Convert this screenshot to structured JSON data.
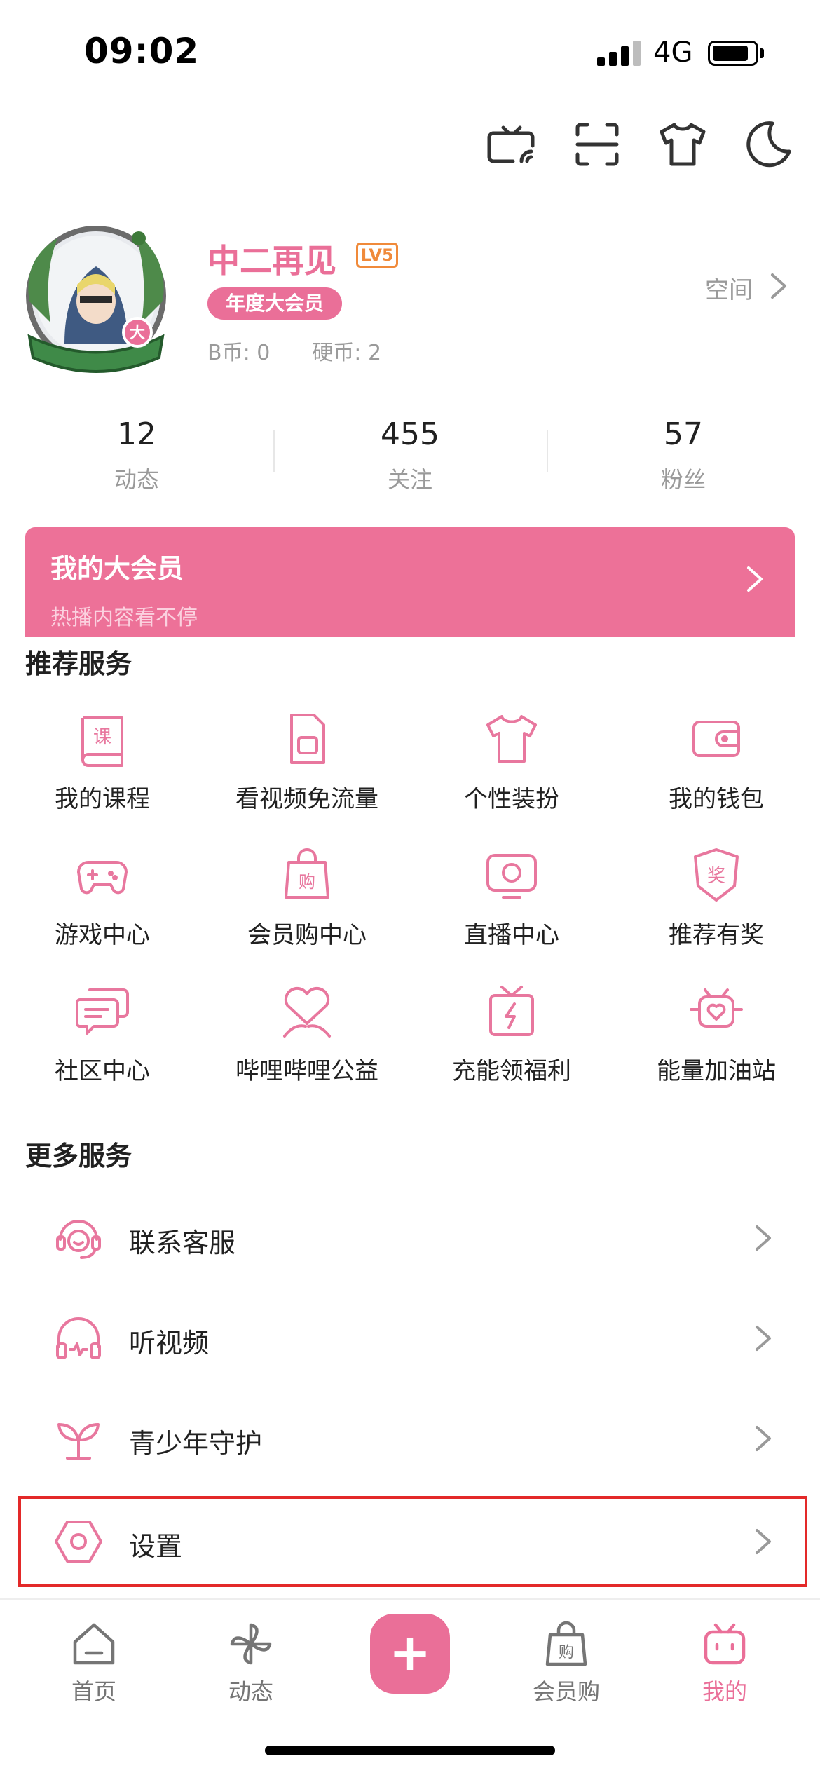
{
  "status_bar": {
    "time": "09:02",
    "network": "4G"
  },
  "top_icons": [
    "tv-cast-icon",
    "scan-icon",
    "shirt-icon",
    "moon-icon"
  ],
  "profile": {
    "username": "中二再见",
    "level": "LV5",
    "vip_badge": "年度大会员",
    "bcoin": "B币: 0",
    "coin": "硬币: 2",
    "space_label": "空间"
  },
  "stats": [
    {
      "value": "12",
      "label": "动态"
    },
    {
      "value": "455",
      "label": "关注"
    },
    {
      "value": "57",
      "label": "粉丝"
    }
  ],
  "vip_banner": {
    "title": "我的大会员",
    "subtitle": "热播内容看不停"
  },
  "recommended": {
    "title": "推荐服务",
    "items": [
      {
        "label": "我的课程",
        "icon": "course-book-icon"
      },
      {
        "label": "看视频免流量",
        "icon": "sim-card-icon"
      },
      {
        "label": "个性装扮",
        "icon": "shirt-icon"
      },
      {
        "label": "我的钱包",
        "icon": "wallet-icon"
      },
      {
        "label": "游戏中心",
        "icon": "gamepad-icon"
      },
      {
        "label": "会员购中心",
        "icon": "shopping-bag-icon"
      },
      {
        "label": "直播中心",
        "icon": "live-tv-icon"
      },
      {
        "label": "推荐有奖",
        "icon": "reward-shield-icon"
      },
      {
        "label": "社区中心",
        "icon": "chat-bubbles-icon"
      },
      {
        "label": "哔哩哔哩公益",
        "icon": "charity-heart-icon"
      },
      {
        "label": "充能领福利",
        "icon": "energy-gift-icon"
      },
      {
        "label": "能量加油站",
        "icon": "energy-station-icon"
      }
    ]
  },
  "more": {
    "title": "更多服务",
    "items": [
      {
        "label": "联系客服",
        "icon": "customer-service-icon"
      },
      {
        "label": "听视频",
        "icon": "headphones-icon"
      },
      {
        "label": "青少年守护",
        "icon": "sprout-icon"
      },
      {
        "label": "设置",
        "icon": "settings-hexagon-icon"
      }
    ]
  },
  "tabbar": {
    "items": [
      {
        "label": "首页",
        "icon": "home-icon"
      },
      {
        "label": "动态",
        "icon": "pinwheel-icon"
      },
      {
        "label": "会员购",
        "icon": "shopping-bag-icon"
      },
      {
        "label": "我的",
        "icon": "tv-mine-icon"
      }
    ],
    "plus": "+"
  },
  "colors": {
    "accent": "#ea6f98",
    "highlight_border": "#e32929"
  }
}
